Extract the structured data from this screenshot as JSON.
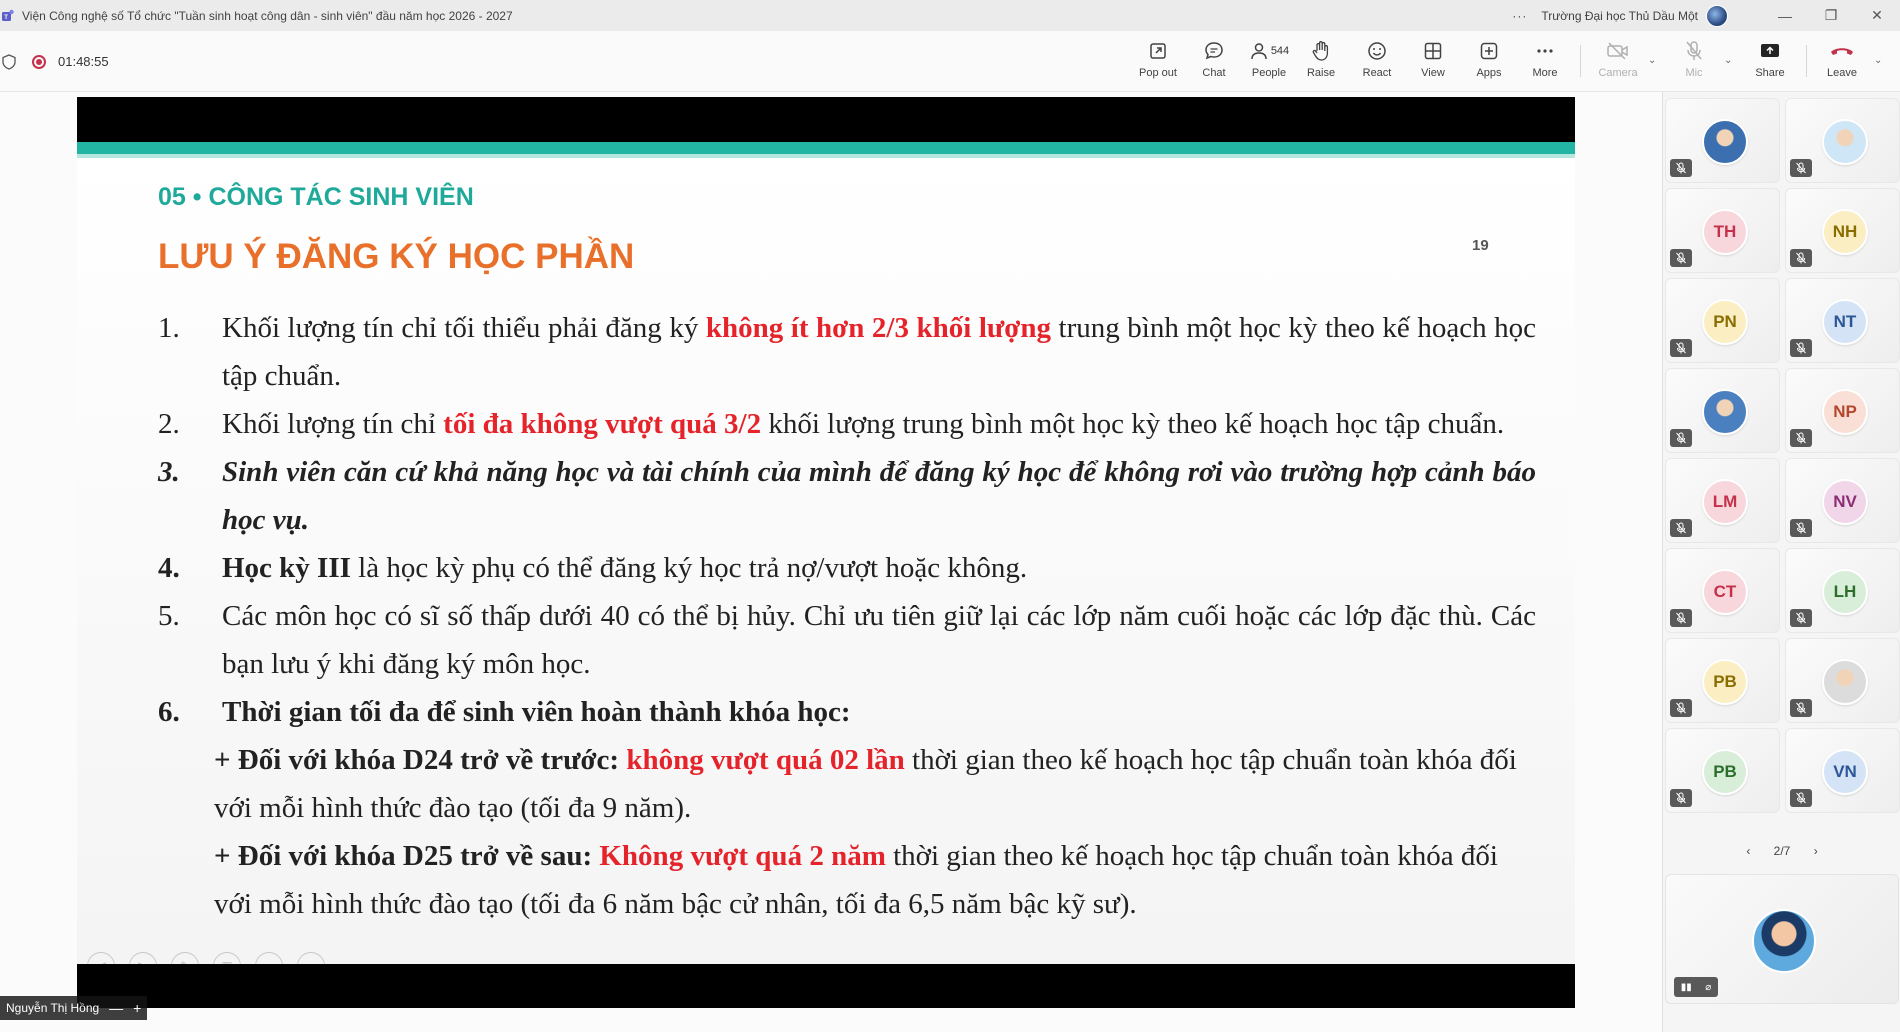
{
  "window": {
    "title": "Viện Công nghệ số Tổ chức \"Tuần sinh hoạt công dân - sinh viên\" đầu năm học 2026 - 2027",
    "more": "···",
    "org": "Trường Đại học Thủ Dầu Một",
    "minimize": "—",
    "restore": "❐",
    "close": "✕"
  },
  "toolbar": {
    "timer": "01:48:55",
    "pop_out": "Pop out",
    "chat": "Chat",
    "people": "People",
    "people_count": "544",
    "raise": "Raise",
    "react": "React",
    "view": "View",
    "apps": "Apps",
    "more": "More",
    "camera": "Camera",
    "mic": "Mic",
    "share": "Share",
    "leave": "Leave"
  },
  "slide": {
    "section": "05 • CÔNG TÁC SINH VIÊN",
    "heading": "LƯU Ý ĐĂNG KÝ HỌC PHẦN",
    "page_number": "19",
    "item1": {
      "num": "1.",
      "a": "Khối lượng tín chỉ tối thiểu phải đăng ký ",
      "red": "không ít hơn 2/3 khối lượng",
      "b": " trung bình một học kỳ theo kế hoạch học tập chuẩn."
    },
    "item2": {
      "num": "2.",
      "a": "Khối lượng tín chỉ ",
      "red": "tối đa không vượt quá 3/2",
      "b": " khối lượng trung bình một học kỳ theo kế hoạch học tập chuẩn."
    },
    "item3": {
      "num": "3.",
      "text": "Sinh viên căn cứ khả năng học và tài chính của mình để đăng ký học để không rơi vào trường hợp cảnh báo học vụ."
    },
    "item4": {
      "num": "4.",
      "bold": "Học kỳ III",
      "rest": " là học kỳ phụ có thể đăng ký học trả nợ/vượt hoặc không."
    },
    "item5": {
      "num": "5.",
      "text": "Các môn học có sĩ số thấp dưới 40 có thể bị hủy. Chỉ ưu tiên giữ lại các lớp năm cuối hoặc các lớp đặc thù. Các bạn lưu ý khi đăng ký môn học."
    },
    "item6": {
      "num": "6.",
      "text": "Thời gian tối đa để sinh viên hoàn thành khóa học:"
    },
    "sub1": {
      "lead": "+ Đối với khóa D24 trở về trước: ",
      "red": "không vượt quá 02 lần",
      "rest": " thời gian theo kế hoạch học tập  chuẩn toàn khóa đối với mỗi hình thức đào tạo (tối đa 9 năm)."
    },
    "sub2": {
      "lead": "+ Đối với khóa D25 trở về sau: ",
      "red": "Không vượt quá 2 năm",
      "rest": " thời gian theo kế hoạch học tập chuẩn toàn khóa đối với mỗi hình thức đào tạo (tối đa 6 năm bậc cử nhân, tối đa 6,5 năm bậc kỹ sư)."
    }
  },
  "presenter": {
    "name": "Nguyễn Thị Hồng",
    "minimize": "—",
    "add": "+"
  },
  "roster": {
    "participants": [
      {
        "initials": "",
        "color": "#3b6fb0"
      },
      {
        "initials": "",
        "color": "#cfe6f7"
      },
      {
        "initials": "TH",
        "color": "#f7d6dc",
        "text": "#c4314b"
      },
      {
        "initials": "NH",
        "color": "#fbeec2",
        "text": "#8a6d00"
      },
      {
        "initials": "PN",
        "color": "#fbeec2",
        "text": "#8a6d00"
      },
      {
        "initials": "NT",
        "color": "#d5e3f7",
        "text": "#2b5796"
      },
      {
        "initials": "",
        "color": "#4a7fc0"
      },
      {
        "initials": "NP",
        "color": "#fadfd6",
        "text": "#b3472b"
      },
      {
        "initials": "LM",
        "color": "#f7d6dc",
        "text": "#c4314b"
      },
      {
        "initials": "NV",
        "color": "#f1d6ea",
        "text": "#8b2e74"
      },
      {
        "initials": "CT",
        "color": "#f7d6dc",
        "text": "#c4314b"
      },
      {
        "initials": "LH",
        "color": "#d8eed8",
        "text": "#2c6e2c"
      },
      {
        "initials": "PB",
        "color": "#fbeec2",
        "text": "#8a6d00"
      },
      {
        "initials": "",
        "color": "#dcdcdc"
      },
      {
        "initials": "PB",
        "color": "#d8eed8",
        "text": "#2c6e2c"
      },
      {
        "initials": "VN",
        "color": "#d5e3f7",
        "text": "#2b5796"
      }
    ],
    "page_indicator": "2/7",
    "prev": "‹",
    "next": "›"
  }
}
